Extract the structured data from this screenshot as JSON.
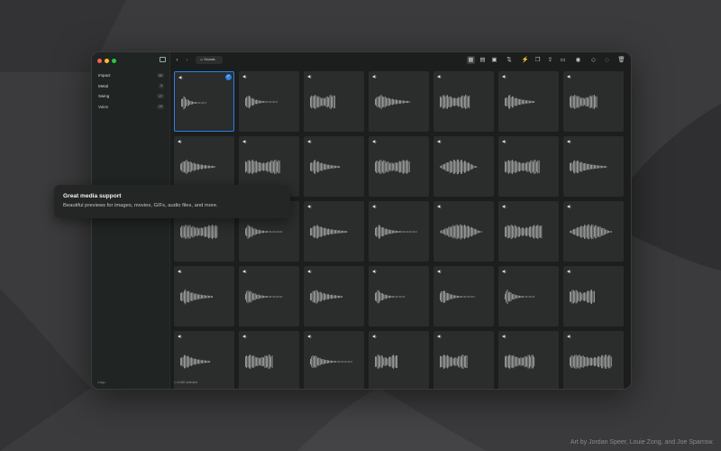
{
  "window": {
    "traffic_colors": [
      "#ff5f57",
      "#febc2e",
      "#28c840"
    ],
    "breadcrumb": "Sounds"
  },
  "sidebar": {
    "items": [
      {
        "label": "Impact",
        "count": "30"
      },
      {
        "label": "Metal",
        "count": "3"
      },
      {
        "label": "Swing",
        "count": "17"
      },
      {
        "label": "Voice",
        "count": "13"
      }
    ],
    "footer": "4 tags"
  },
  "toolbar": {
    "icons": [
      "sidebar-icon",
      "back-icon",
      "forward-icon",
      "folder-icon",
      "grid-view-icon",
      "list-view-icon",
      "gallery-view-icon",
      "sort-icon",
      "bolt-icon",
      "copy-icon",
      "share-icon",
      "folder-open-icon",
      "eye-icon",
      "tag-icon",
      "tag-off-icon",
      "trash-icon"
    ]
  },
  "grid": {
    "columns": 7,
    "rows": 5,
    "selected_index": 0,
    "accent": "#2a82e4",
    "cells": [
      {
        "shape": "spike",
        "len": 0.55
      },
      {
        "shape": "spike",
        "len": 0.7
      },
      {
        "shape": "block",
        "len": 0.55
      },
      {
        "shape": "decay",
        "len": 0.75
      },
      {
        "shape": "block",
        "len": 0.65
      },
      {
        "shape": "decay",
        "len": 0.65
      },
      {
        "shape": "block",
        "len": 0.6
      },
      {
        "shape": "decay",
        "len": 0.75
      },
      {
        "shape": "block",
        "len": 0.75
      },
      {
        "shape": "decay",
        "len": 0.65
      },
      {
        "shape": "block",
        "len": 0.75
      },
      {
        "shape": "swell",
        "len": 0.8
      },
      {
        "shape": "block",
        "len": 0.75
      },
      {
        "shape": "decay",
        "len": 0.8
      },
      {
        "shape": "block",
        "len": 0.8
      },
      {
        "shape": "spike",
        "len": 0.8
      },
      {
        "shape": "decay",
        "len": 0.8
      },
      {
        "shape": "spike",
        "len": 0.9
      },
      {
        "shape": "swell",
        "len": 0.9
      },
      {
        "shape": "block",
        "len": 0.8
      },
      {
        "shape": "swell",
        "len": 0.9
      },
      {
        "shape": "decay",
        "len": 0.7
      },
      {
        "shape": "spike",
        "len": 0.8
      },
      {
        "shape": "decay",
        "len": 0.7
      },
      {
        "shape": "spike",
        "len": 0.65
      },
      {
        "shape": "spike",
        "len": 0.75
      },
      {
        "shape": "spike",
        "len": 0.65
      },
      {
        "shape": "block",
        "len": 0.55
      },
      {
        "shape": "decay",
        "len": 0.65
      },
      {
        "shape": "block",
        "len": 0.6
      },
      {
        "shape": "spike",
        "len": 0.9
      },
      {
        "shape": "block",
        "len": 0.5
      },
      {
        "shape": "block",
        "len": 0.6
      },
      {
        "shape": "block",
        "len": 0.65
      },
      {
        "shape": "block",
        "len": 0.9
      }
    ]
  },
  "status": {
    "selection": "1 of 460 selected",
    "zoom_level": 0.6
  },
  "tooltip": {
    "title": "Great media support",
    "subtitle": "Beautiful previews for images, movies, GIFs, audio files, and more."
  },
  "credit": "Art by Jordan Speer, Louie Zong, and Joe Sparrow."
}
